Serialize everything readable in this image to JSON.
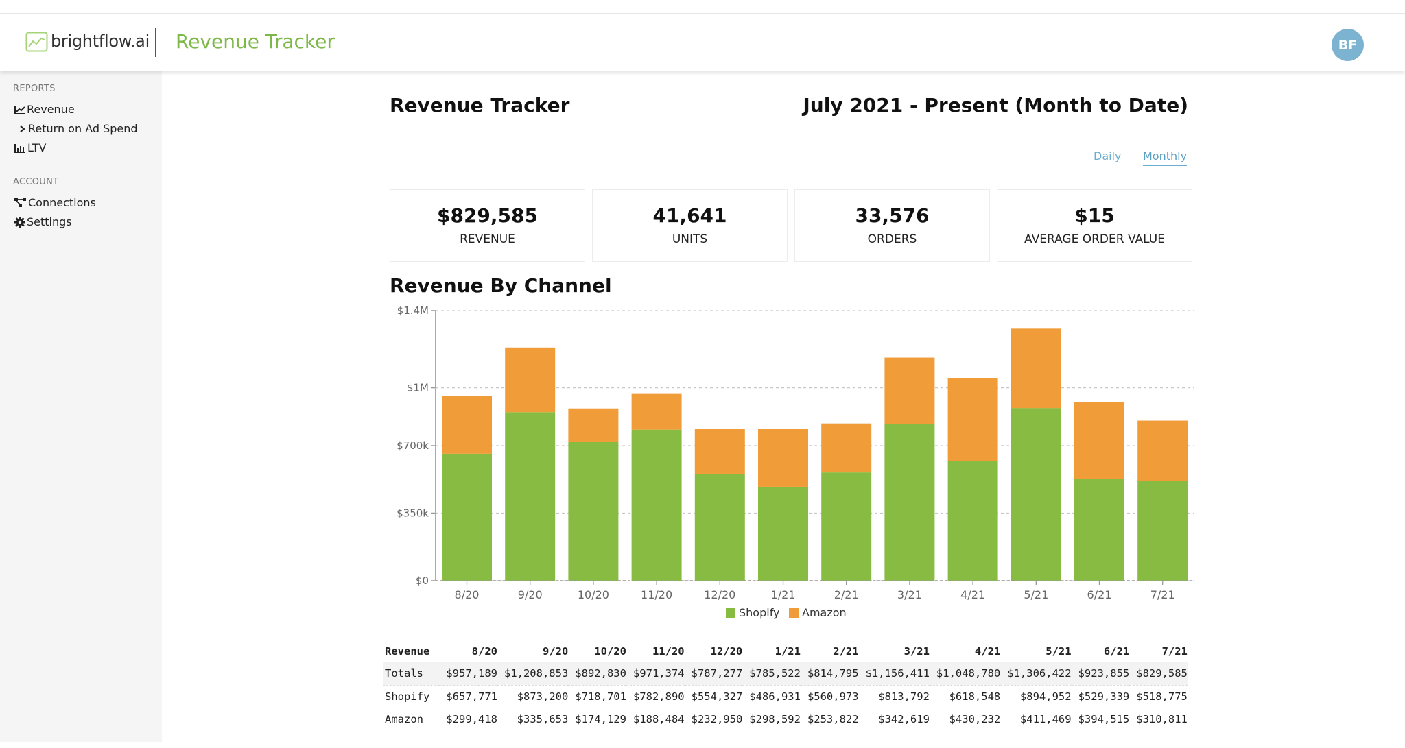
{
  "header": {
    "brand": "brightflow.ai",
    "app_title": "Revenue Tracker",
    "avatar_initials": "BF",
    "brand_color": "#7cb847"
  },
  "sidebar": {
    "sections": [
      {
        "title": "REPORTS",
        "items": [
          {
            "label": "Revenue",
            "icon": "line-chart-icon"
          },
          {
            "label": "Return on Ad Spend",
            "icon": "chevron-right-icon"
          },
          {
            "label": "LTV",
            "icon": "bar-chart-icon"
          }
        ]
      },
      {
        "title": "ACCOUNT",
        "items": [
          {
            "label": "Connections",
            "icon": "connections-icon"
          },
          {
            "label": "Settings",
            "icon": "gear-icon"
          }
        ]
      }
    ]
  },
  "main": {
    "title": "Revenue Tracker",
    "date_range": "July 2021 - Present (Month to Date)",
    "toggles": [
      {
        "label": "Daily",
        "active": false
      },
      {
        "label": "Monthly",
        "active": true
      }
    ],
    "kpis": [
      {
        "value": "$829,585",
        "label": "REVENUE"
      },
      {
        "value": "41,641",
        "label": "UNITS"
      },
      {
        "value": "33,576",
        "label": "ORDERS"
      },
      {
        "value": "$15",
        "label": "AVERAGE ORDER VALUE"
      }
    ],
    "chart_title": "Revenue By Channel",
    "table": {
      "header": [
        "Revenue",
        "8/20",
        "9/20",
        "10/20",
        "11/20",
        "12/20",
        "1/21",
        "2/21",
        "3/21",
        "4/21",
        "5/21",
        "6/21",
        "7/21"
      ],
      "rows": [
        [
          "Totals",
          "$957,189",
          "$1,208,853",
          "$892,830",
          "$971,374",
          "$787,277",
          "$785,522",
          "$814,795",
          "$1,156,411",
          "$1,048,780",
          "$1,306,422",
          "$923,855",
          "$829,585"
        ],
        [
          "Shopify",
          "$657,771",
          "$873,200",
          "$718,701",
          "$782,890",
          "$554,327",
          "$486,931",
          "$560,973",
          "$813,792",
          "$618,548",
          "$894,952",
          "$529,339",
          "$518,775"
        ],
        [
          "Amazon",
          "$299,418",
          "$335,653",
          "$174,129",
          "$188,484",
          "$232,950",
          "$298,592",
          "$253,822",
          "$342,619",
          "$430,232",
          "$411,469",
          "$394,515",
          "$310,811"
        ]
      ]
    }
  },
  "chart_data": {
    "type": "bar",
    "stacked": true,
    "title": "Revenue By Channel",
    "xlabel": "",
    "ylabel": "",
    "categories": [
      "8/20",
      "9/20",
      "10/20",
      "11/20",
      "12/20",
      "1/21",
      "2/21",
      "3/21",
      "4/21",
      "5/21",
      "6/21",
      "7/21"
    ],
    "series": [
      {
        "name": "Shopify",
        "color": "#88bb42",
        "values": [
          657771,
          873200,
          718701,
          782890,
          554327,
          486931,
          560973,
          813792,
          618548,
          894952,
          529339,
          518775
        ]
      },
      {
        "name": "Amazon",
        "color": "#f09c38",
        "values": [
          299418,
          335653,
          174129,
          188484,
          232950,
          298592,
          253822,
          342619,
          430232,
          411469,
          394515,
          310811
        ]
      }
    ],
    "ylim": [
      0,
      1400000
    ],
    "yticks": [
      0,
      350000,
      700000,
      1000000,
      1400000
    ],
    "ytick_labels": [
      "$0",
      "$350k",
      "$700k",
      "$1M",
      "$1.4M"
    ],
    "grid": true,
    "legend": "bottom-center"
  }
}
